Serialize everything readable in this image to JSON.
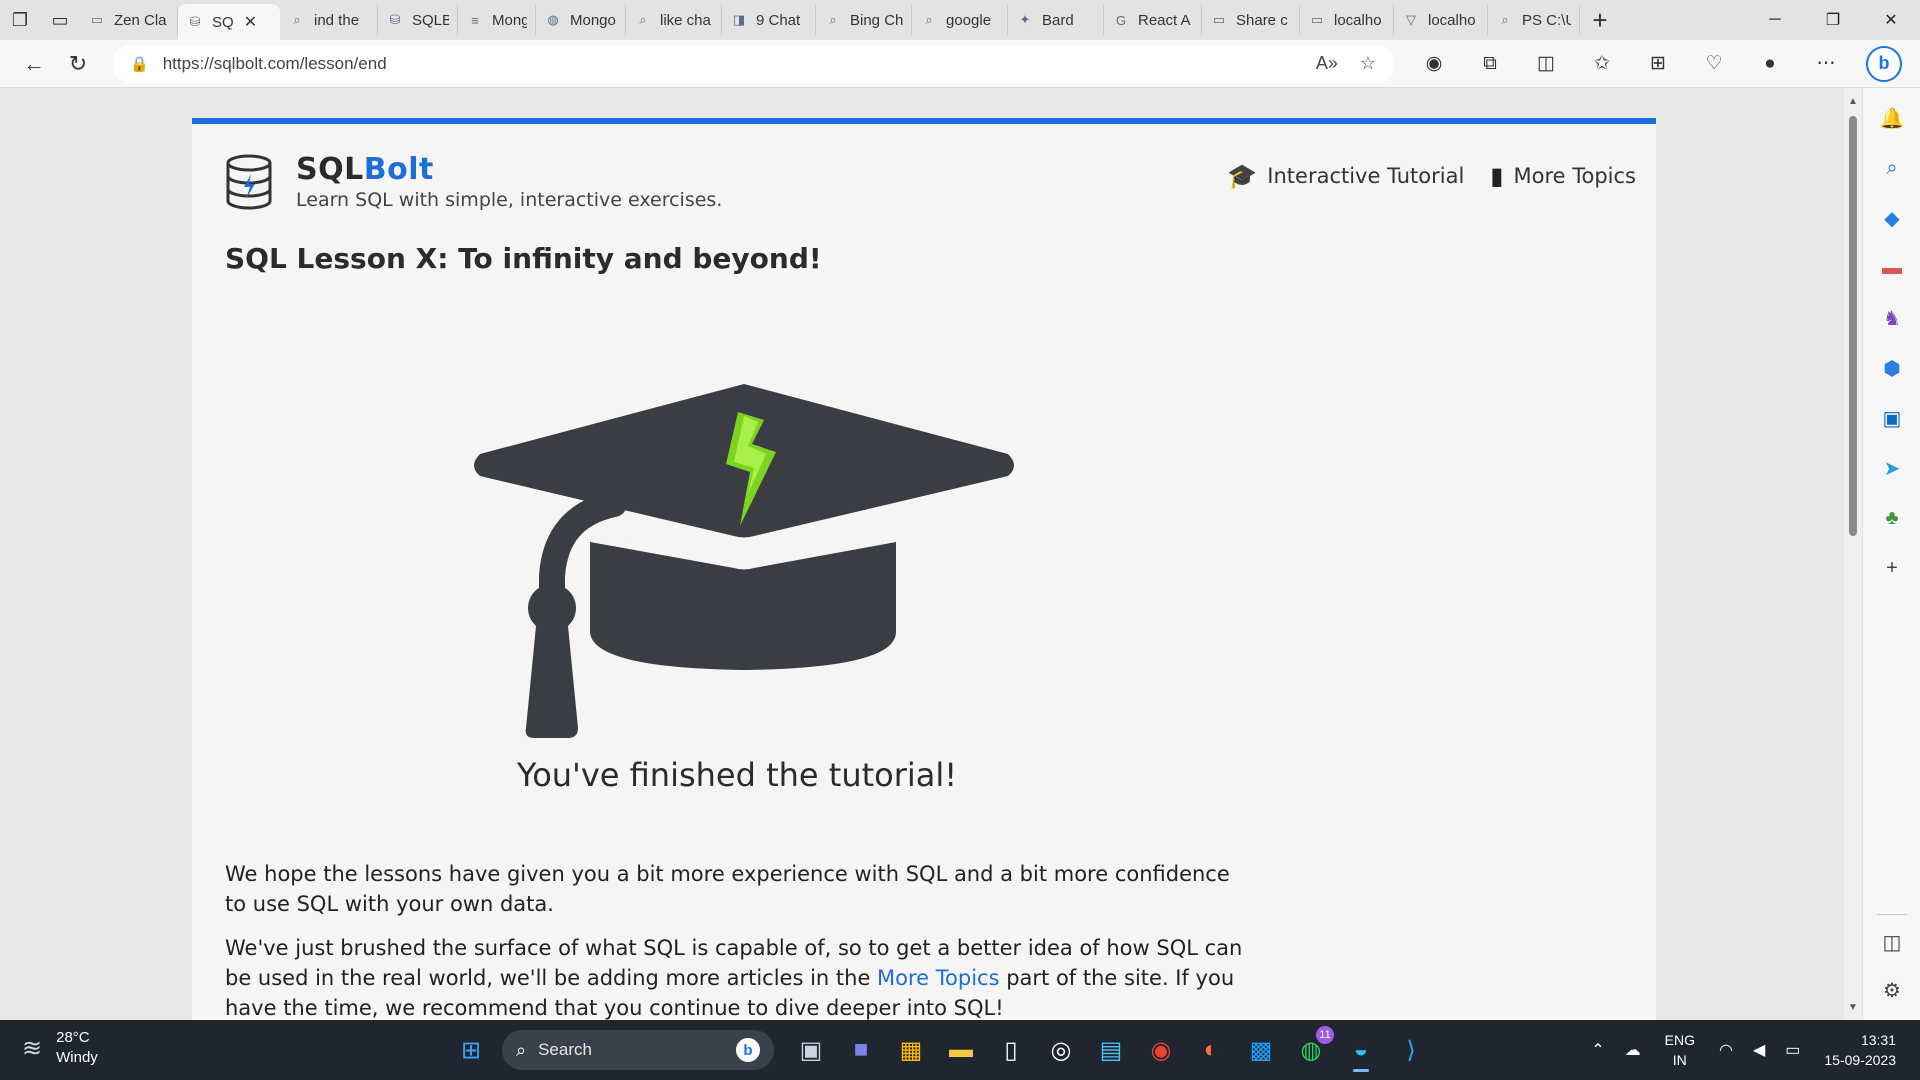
{
  "browser": {
    "tabs": [
      {
        "label": "Zen Cla",
        "icon": "page-icon"
      },
      {
        "label": "SQ",
        "icon": "database-icon",
        "active": true
      },
      {
        "label": "ind the",
        "icon": "search-icon"
      },
      {
        "label": "SQLBol",
        "icon": "database-icon"
      },
      {
        "label": "Mongo",
        "icon": "doc-icon"
      },
      {
        "label": "Mongo",
        "icon": "globe-icon"
      },
      {
        "label": "like cha",
        "icon": "search-icon"
      },
      {
        "label": "9 Chat",
        "icon": "chat-icon"
      },
      {
        "label": "Bing Ch",
        "icon": "search-icon"
      },
      {
        "label": "google",
        "icon": "search-icon"
      },
      {
        "label": "Bard",
        "icon": "sparkle-icon"
      },
      {
        "label": "React A",
        "icon": "google-icon"
      },
      {
        "label": "Share c",
        "icon": "page-icon"
      },
      {
        "label": "localho",
        "icon": "page-icon"
      },
      {
        "label": "localho",
        "icon": "vite-icon"
      },
      {
        "label": "PS C:\\U",
        "icon": "search-icon"
      }
    ],
    "url": "https://sqlbolt.com/lesson/end"
  },
  "site": {
    "brand_prefix": "SQL",
    "brand_accent": "Bolt",
    "tagline": "Learn SQL with simple, interactive exercises.",
    "nav": [
      {
        "label": "Interactive Tutorial",
        "icon": "graduation-cap-icon"
      },
      {
        "label": "More Topics",
        "icon": "book-icon"
      }
    ],
    "accent_color": "#1c6fd9"
  },
  "lesson": {
    "title": "SQL Lesson X: To infinity and beyond!",
    "finished": "You've finished the tutorial!",
    "para1": "We hope the lessons have given you a bit more experience with SQL and a bit more confidence to use SQL with your own data.",
    "para2_before": "We've just brushed the surface of what SQL is capable of, so to get a better idea of how SQL can be used in the real world, we'll be adding more articles in the ",
    "para2_link": "More Topics",
    "para2_after": " part of the site. If you have the time, we recommend that you continue to dive deeper into SQL!"
  },
  "taskbar": {
    "temperature": "28°C",
    "weather": "Windy",
    "search_placeholder": "Search",
    "whatsapp_badge": "11",
    "lang_top": "ENG",
    "lang_bottom": "IN",
    "time": "13:31",
    "date": "15-09-2023"
  }
}
